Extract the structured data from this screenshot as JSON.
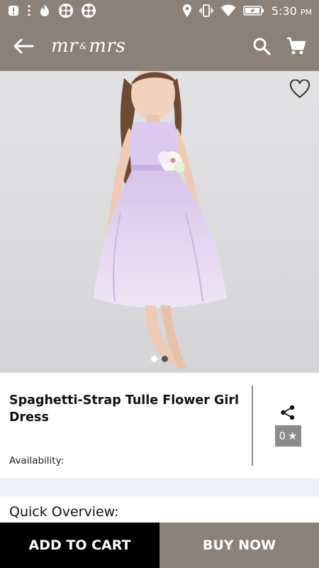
{
  "status_bar": {
    "time": "5:30",
    "time_suffix": "PM",
    "icons": [
      "alert-icon",
      "more-vert-icon",
      "flame-icon",
      "clover-icon",
      "clover-icon",
      "location-icon",
      "vibrate-icon",
      "wifi-icon",
      "battery-charging-icon"
    ]
  },
  "app_bar": {
    "logo_left": "mr",
    "logo_knot": "&",
    "logo_right": "mrs",
    "icons": [
      "back-arrow-icon",
      "search-icon",
      "cart-icon"
    ]
  },
  "product": {
    "title": "Spaghetti-Strap Tulle Flower Girl Dress",
    "availability_label": "Availability:",
    "rating": "0",
    "rating_star": "★",
    "image_count": 2,
    "active_image": 1
  },
  "sections": {
    "overview_title": "Quick Overview:"
  },
  "actions": {
    "add_to_cart": "ADD TO CART",
    "buy_now": "BUY NOW"
  },
  "colors": {
    "brand": "#8b8178",
    "primary_button": "#000000",
    "rating_badge": "#8c8c8c",
    "band": "#eef0f8"
  }
}
